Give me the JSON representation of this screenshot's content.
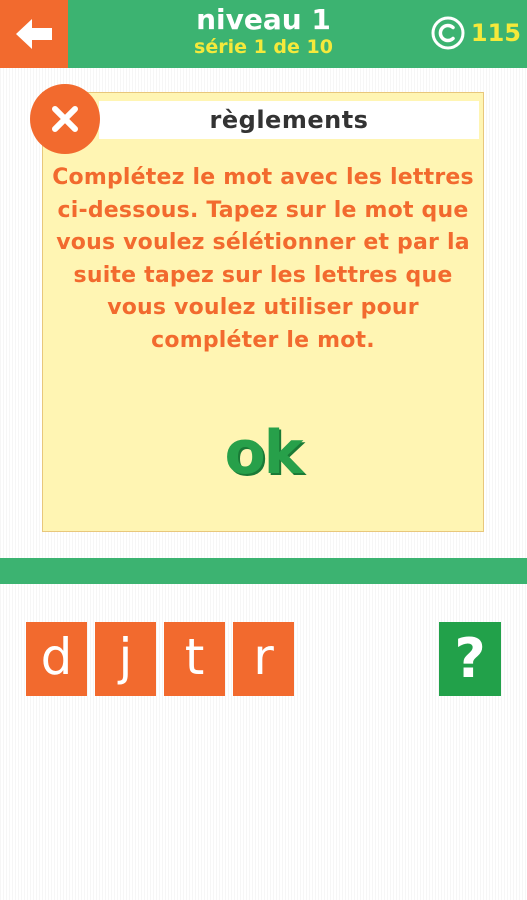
{
  "header": {
    "level_title": "niveau 1",
    "series_subtitle": "série 1 de 10",
    "coins": "115",
    "back_icon": "arrow-left-icon",
    "coin_icon": "coin-c-icon"
  },
  "rules_modal": {
    "title": "règlements",
    "text": "Complétez le mot avec les lettres ci-dessous. Tapez sur le mot que vous voulez sélétionner et par la suite tapez sur les lettres que vous voulez utiliser pour compléter le mot.",
    "ok_label": "ok",
    "close_icon": "close-x-icon"
  },
  "letters": [
    "d",
    "j",
    "t",
    "r"
  ],
  "hint_label": "?",
  "colors": {
    "green": "#3cb371",
    "orange": "#f26a2e",
    "yellow": "#f5e93b",
    "modal_bg": "#fff5b3",
    "ok_green": "#27a04a"
  }
}
